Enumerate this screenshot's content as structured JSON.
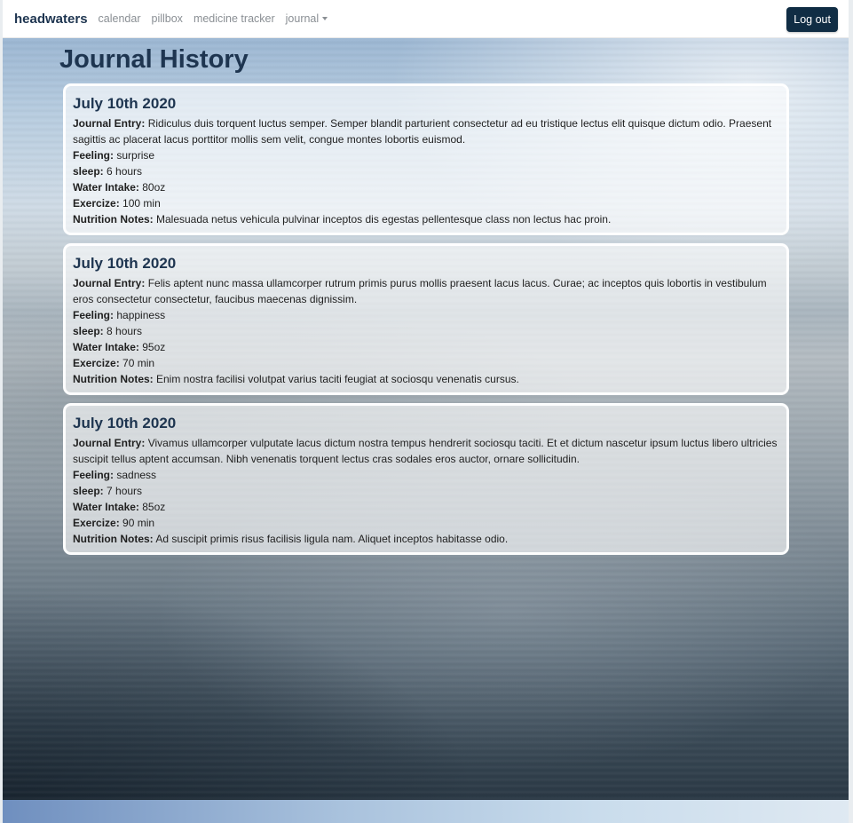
{
  "navbar": {
    "brand": "headwaters",
    "links": [
      {
        "label": "calendar"
      },
      {
        "label": "pillbox"
      },
      {
        "label": "medicine tracker"
      },
      {
        "label": "journal"
      }
    ],
    "logout_label": "Log out"
  },
  "page": {
    "title": "Journal History"
  },
  "labels": {
    "entry": "Journal Entry:",
    "feeling": "Feeling:",
    "sleep": "sleep:",
    "water": "Water Intake:",
    "exercise": "Exercize:",
    "nutrition": "Nutrition Notes:"
  },
  "entries": [
    {
      "date": "July 10th 2020",
      "entry": "Ridiculus duis torquent luctus semper. Semper blandit parturient consectetur ad eu tristique lectus elit quisque dictum odio. Praesent sagittis ac placerat lacus porttitor mollis sem velit, congue montes lobortis euismod.",
      "feeling": "surprise",
      "sleep": "6 hours",
      "water": "80oz",
      "exercise": "100 min",
      "nutrition": "Malesuada netus vehicula pulvinar inceptos dis egestas pellentesque class non lectus hac proin."
    },
    {
      "date": "July 10th 2020",
      "entry": "Felis aptent nunc massa ullamcorper rutrum primis purus mollis praesent lacus lacus. Curae; ac inceptos quis lobortis in vestibulum eros consectetur consectetur, faucibus maecenas dignissim.",
      "feeling": "happiness",
      "sleep": "8 hours",
      "water": "95oz",
      "exercise": "70 min",
      "nutrition": "Enim nostra facilisi volutpat varius taciti feugiat at sociosqu venenatis cursus."
    },
    {
      "date": "July 10th 2020",
      "entry": "Vivamus ullamcorper vulputate lacus dictum nostra tempus hendrerit sociosqu taciti. Et et dictum nascetur ipsum luctus libero ultricies suscipit tellus aptent accumsan. Nibh venenatis torquent lectus cras sodales eros auctor, ornare sollicitudin.",
      "feeling": "sadness",
      "sleep": "7 hours",
      "water": "85oz",
      "exercise": "90 min",
      "nutrition": "Ad suscipit primis risus facilisis ligula nam. Aliquet inceptos habitasse odio."
    }
  ]
}
